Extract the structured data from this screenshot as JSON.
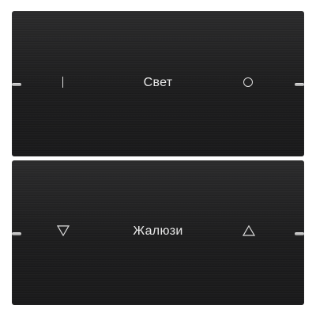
{
  "light_rocker": {
    "label": "Свет",
    "left_symbol": "on-bar-icon",
    "right_symbol": "off-circle-icon"
  },
  "blinds_rocker": {
    "label": "Жалюзи",
    "left_symbol": "triangle-down-icon",
    "right_symbol": "triangle-up-icon"
  },
  "colors": {
    "panel": "#1c1c1d",
    "text": "#e8e8e8",
    "led": "#c8c8c8"
  }
}
